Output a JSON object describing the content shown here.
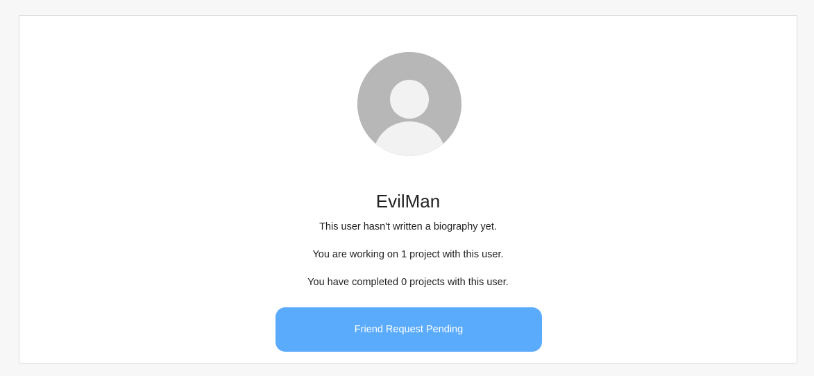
{
  "profile": {
    "avatar_icon": "default-user-avatar-icon",
    "username": "EvilMan",
    "biography": "This user hasn't written a biography yet.",
    "working_on": "You are working on 1 project with this user.",
    "completed": "You have completed 0 projects with this user."
  },
  "actions": {
    "friend_request_label": "Friend Request Pending"
  },
  "colors": {
    "button_bg": "#5aabfc",
    "avatar_bg": "#b7b7b7",
    "avatar_figure": "#f2f2f2",
    "page_bg": "#f7f7f7"
  }
}
